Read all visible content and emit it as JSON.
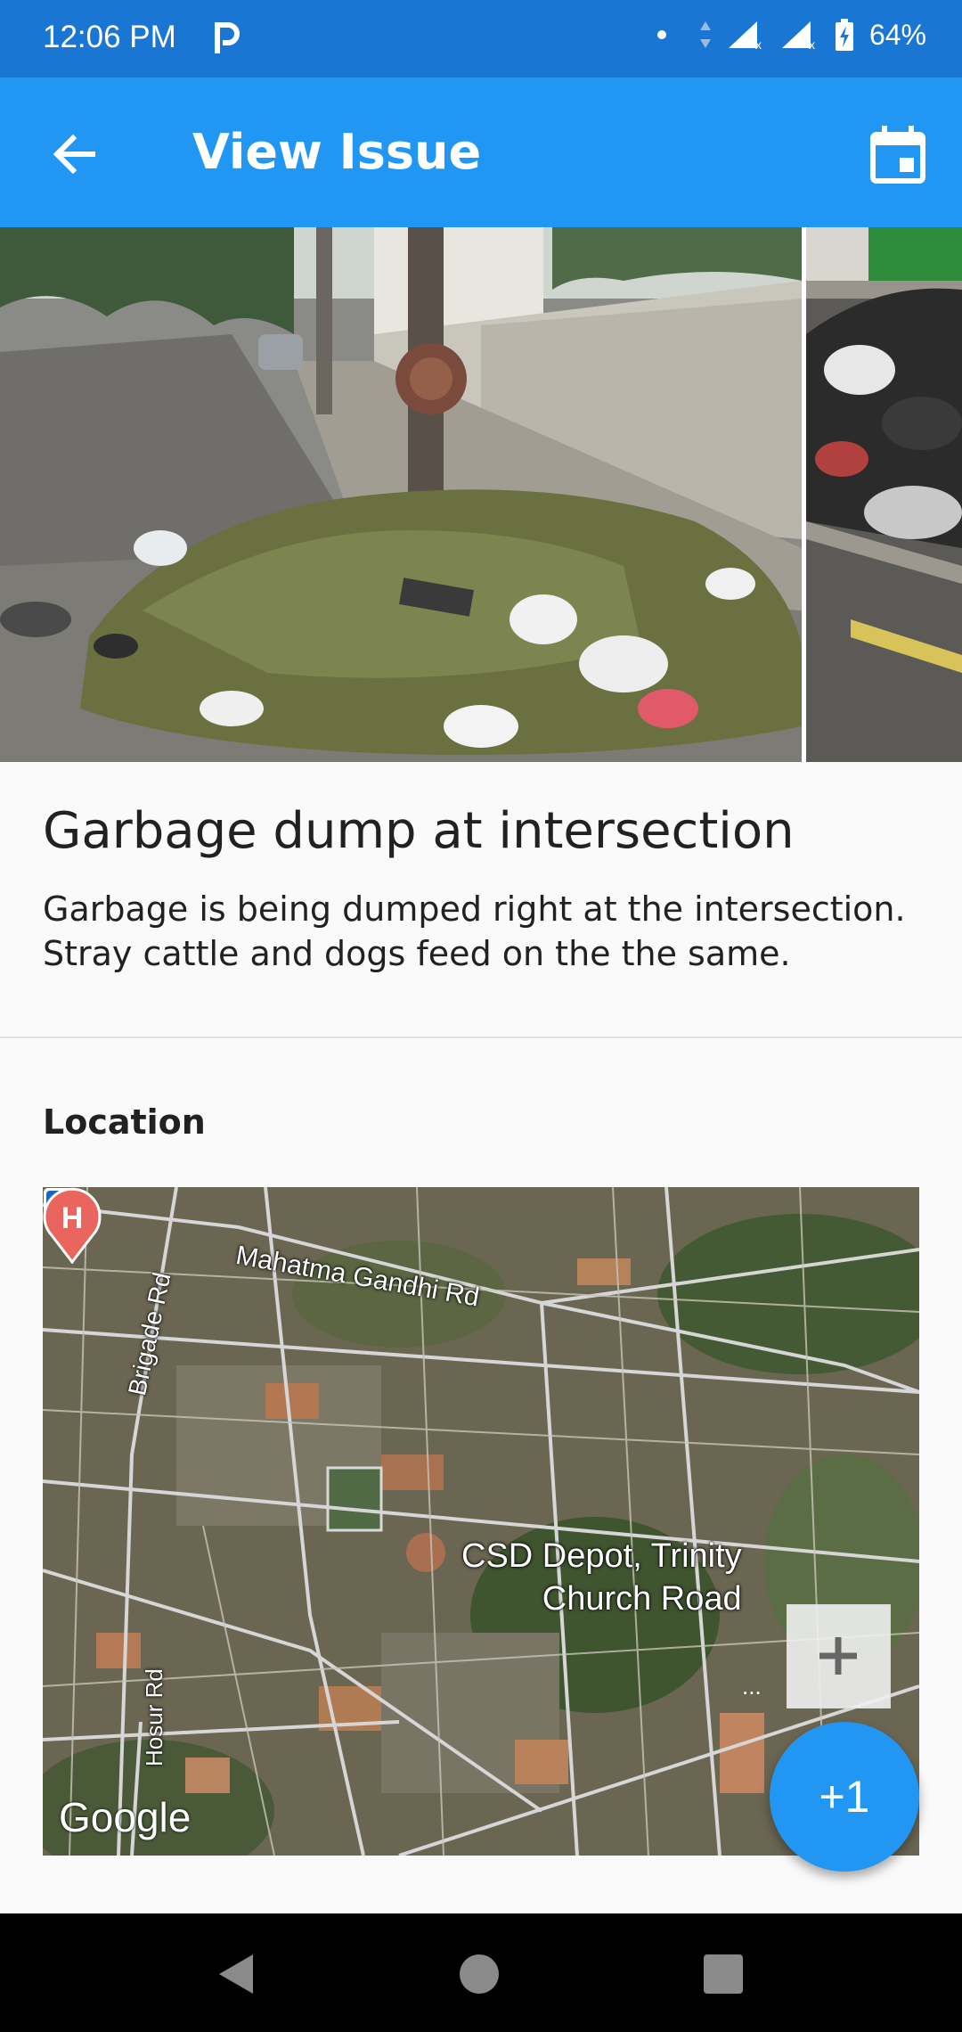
{
  "status_bar": {
    "time": "12:06 PM",
    "battery": "64%",
    "icons": [
      "parking-app-icon",
      "dot-icon",
      "data-arrows-icon",
      "signal-icon",
      "signal-icon",
      "battery-charging-icon"
    ]
  },
  "app_bar": {
    "title": "View Issue",
    "back_icon": "arrow-back-icon",
    "action_icon": "calendar-icon",
    "color": "#2196f3"
  },
  "issue": {
    "title": "Garbage dump at intersection",
    "description": "Garbage is being dumped right at the intersection. Stray cattle and dogs feed on the the same."
  },
  "location": {
    "label": "Location",
    "map": {
      "roads": [
        "Mahatma Gandhi Rd",
        "Brigade Rd",
        "Hosur Rd"
      ],
      "place_label_line1": "CSD Depot, Trinity",
      "place_label_line2": "Church Road",
      "hospital_marker": "H",
      "metro_marker": "M",
      "attribution": "Google",
      "zoom_in": "+",
      "more": "..."
    }
  },
  "fab": {
    "label": "+1"
  },
  "nav_bar": {
    "icons": [
      "nav-back-icon",
      "nav-home-icon",
      "nav-recents-icon"
    ]
  }
}
